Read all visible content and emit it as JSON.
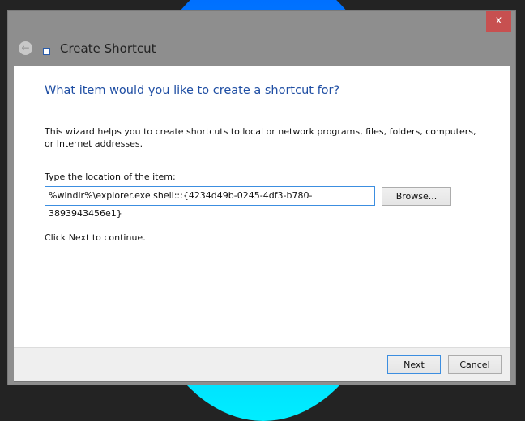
{
  "window": {
    "title": "Create Shortcut",
    "close_label": "x",
    "back_icon": "back-arrow-icon"
  },
  "content": {
    "heading": "What item would you like to create a shortcut for?",
    "description": "This wizard helps you to create shortcuts to local or network programs, files, folders, computers, or Internet addresses.",
    "location_label": "Type the location of the item:",
    "location_value": "%windir%\\explorer.exe shell:::{4234d49b-0245-4df3-b780-3893943456e1}",
    "browse_label": "Browse...",
    "continue_text": "Click Next to continue."
  },
  "footer": {
    "next_label": "Next",
    "cancel_label": "Cancel"
  }
}
